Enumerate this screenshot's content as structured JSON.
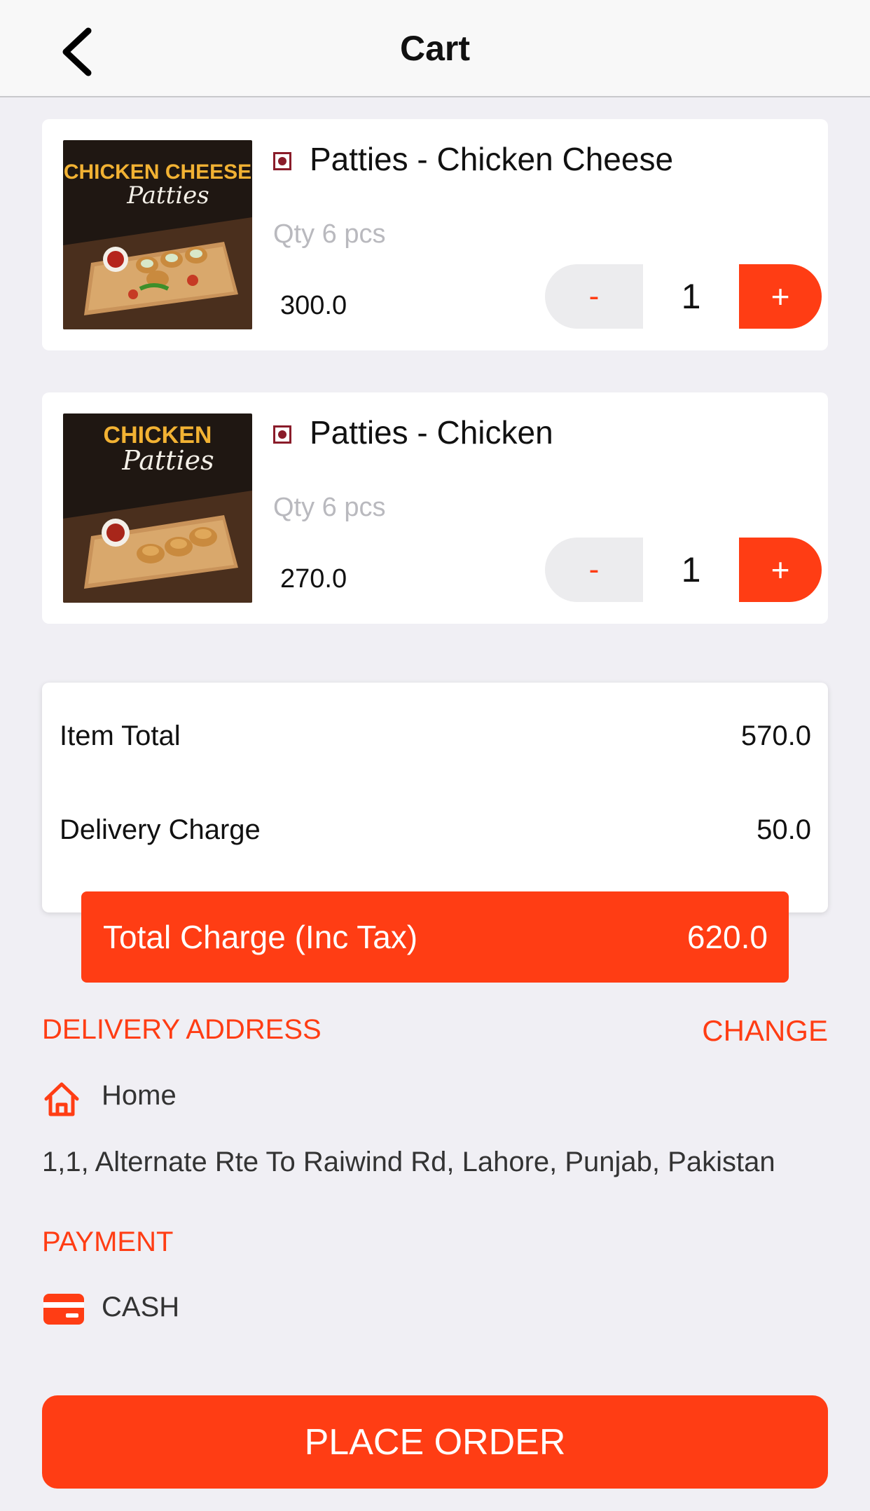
{
  "header": {
    "title": "Cart"
  },
  "cart": {
    "items": [
      {
        "name": "Patties - Chicken Cheese",
        "qty_label": "Qty 6 pcs",
        "price": "300.0",
        "quantity": "1",
        "image_text_top": "CHICKEN CHEESE",
        "image_text_script": "Patties"
      },
      {
        "name": "Patties - Chicken",
        "qty_label": "Qty 6 pcs",
        "price": "270.0",
        "quantity": "1",
        "image_text_top": "CHICKEN",
        "image_text_script": "Patties"
      }
    ],
    "stepper": {
      "minus": "-",
      "plus": "+"
    }
  },
  "summary": {
    "item_total_label": "Item Total",
    "item_total_value": "570.0",
    "delivery_label": "Delivery Charge",
    "delivery_value": "50.0",
    "total_label": "Total Charge (Inc Tax)",
    "total_value": "620.0"
  },
  "delivery": {
    "section_label": "DELIVERY ADDRESS",
    "change_label": "CHANGE",
    "address_type": "Home",
    "address_line": "1,1, Alternate Rte To Raiwind Rd, Lahore, Punjab, Pakistan"
  },
  "payment": {
    "section_label": "PAYMENT",
    "method": "CASH"
  },
  "place_order_label": "PLACE ORDER",
  "colors": {
    "accent": "#ff3d14",
    "background": "#f0eff4",
    "veg_mark": "#8a1c2a"
  },
  "icons": [
    "chevron-left-icon",
    "home-icon",
    "credit-card-icon"
  ]
}
